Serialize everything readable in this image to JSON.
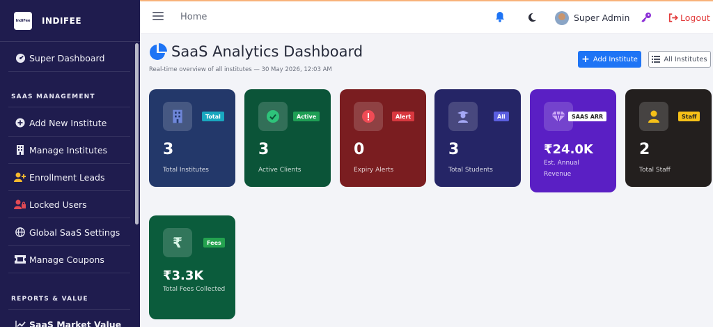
{
  "brand": {
    "name": "INDIFEE",
    "logo_text": "IndiFee"
  },
  "sidebar": {
    "items": [
      {
        "label": "Super Dashboard",
        "icon": "speedometer-icon"
      },
      {
        "label": "Add New Institute",
        "icon": "plus-circle-icon"
      },
      {
        "label": "Manage Institutes",
        "icon": "building-icon"
      },
      {
        "label": "Enrollment Leads",
        "icon": "user-plus-icon"
      },
      {
        "label": "Locked Users",
        "icon": "user-lock-icon"
      },
      {
        "label": "Global SaaS Settings",
        "icon": "globe-icon"
      },
      {
        "label": "Manage Coupons",
        "icon": "ticket-icon"
      },
      {
        "label": "SaaS Market Value",
        "icon": "chart-line-icon"
      }
    ],
    "sections": {
      "saas": "SAAS MANAGEMENT",
      "reports": "REPORTS & VALUE"
    }
  },
  "topbar": {
    "home": "Home",
    "user_name": "Super Admin",
    "logout": "Logout"
  },
  "header": {
    "title": "SaaS Analytics Dashboard",
    "subtitle": "Real-time overview of all institutes — 30 May 2026, 12:03 AM",
    "add_button": "Add Institute",
    "all_button": "All Institutes"
  },
  "cards": [
    {
      "value": "3",
      "label": "Total Institutes",
      "badge": "Total",
      "icon": "building-icon",
      "bg": "#23386a",
      "badge_bg": "#19a8c0",
      "badge_color": "#ffffff"
    },
    {
      "value": "3",
      "label": "Active Clients",
      "badge": "Active",
      "icon": "check-circle-icon",
      "bg": "#0b5438",
      "badge_bg": "#1f9f55",
      "badge_color": "#ffffff"
    },
    {
      "value": "0",
      "label": "Expiry Alerts",
      "badge": "Alert",
      "icon": "exclamation-circle-icon",
      "bg": "#7a1d20",
      "badge_bg": "#d9383f",
      "badge_color": "#ffffff"
    },
    {
      "value": "3",
      "label": "Total Students",
      "badge": "All",
      "icon": "graduate-icon",
      "bg": "#252566",
      "badge_bg": "#5b5fe0",
      "badge_color": "#ffffff"
    },
    {
      "value": "₹24.0K",
      "label": "Est. Annual Revenue",
      "badge": "SAAS ARR",
      "icon": "gem-icon",
      "bg": "#5a1fc4",
      "badge_bg": "#ffffff",
      "badge_color": "#222222"
    },
    {
      "value": "2",
      "label": "Total Staff",
      "badge": "Staff",
      "icon": "staff-icon",
      "bg": "#231f1e",
      "badge_bg": "#f5c018",
      "badge_color": "#222222"
    },
    {
      "value": "₹3.3K",
      "label": "Total Fees Collected",
      "badge": "Fees",
      "icon": "rupee-icon",
      "bg": "#0b5c3c",
      "badge_bg": "#24a24f",
      "badge_color": "#ffffff"
    }
  ]
}
